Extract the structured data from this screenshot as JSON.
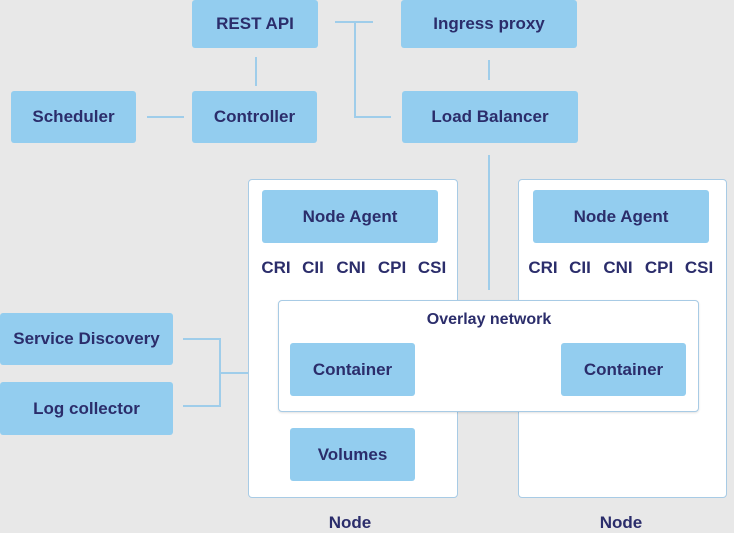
{
  "colors": {
    "background": "#e8e8e8",
    "box": "#93cdef",
    "text": "#2b2d6b",
    "connector": "#9fcdea"
  },
  "top": {
    "rest_api": "REST API",
    "ingress_proxy": "Ingress proxy",
    "scheduler": "Scheduler",
    "controller": "Controller",
    "load_balancer": "Load Balancer"
  },
  "left": {
    "service_discovery": "Service Discovery",
    "log_collector": "Log collector"
  },
  "nodes": [
    {
      "label": "Node",
      "agent": "Node Agent",
      "interfaces": [
        "CRI",
        "CII",
        "CNI",
        "CPI",
        "CSI"
      ],
      "volumes": "Volumes",
      "container": "Container"
    },
    {
      "label": "Node",
      "agent": "Node Agent",
      "interfaces": [
        "CRI",
        "CII",
        "CNI",
        "CPI",
        "CSI"
      ],
      "container": "Container"
    }
  ],
  "overlay": {
    "title": "Overlay network"
  }
}
